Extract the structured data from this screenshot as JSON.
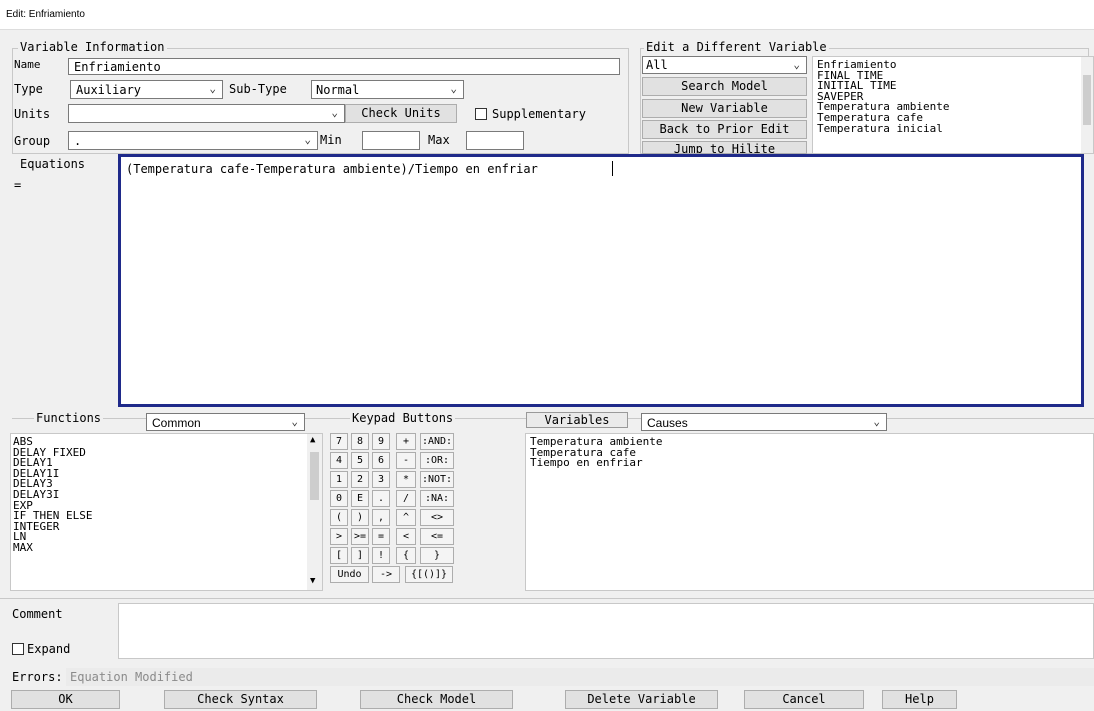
{
  "window_title": "Edit: Enfriamiento",
  "variable_info": {
    "legend": "Variable Information",
    "name_label": "Name",
    "name_value": "Enfriamiento",
    "type_label": "Type",
    "type_value": "Auxiliary",
    "subtype_label": "Sub-Type",
    "subtype_value": "Normal",
    "units_label": "Units",
    "units_value": "",
    "check_units": "Check Units",
    "supplementary": "Supplementary",
    "group_label": "Group",
    "group_value": ".",
    "min_label": "Min",
    "max_label": "Max"
  },
  "edit_different": {
    "legend": "Edit a Different Variable",
    "filter_value": "All",
    "search_model": "Search Model",
    "new_variable": "New Variable",
    "back_prior": "Back to Prior Edit",
    "jump_hilite": "Jump to Hilite",
    "variables": [
      "Enfriamiento",
      "FINAL TIME",
      "INITIAL TIME",
      "SAVEPER",
      "Temperatura ambiente",
      "Temperatura cafe",
      "Temperatura inicial"
    ]
  },
  "equations": {
    "label": "Equations",
    "equals": "=",
    "text": "(Temperatura cafe-Temperatura ambiente)/Tiempo en enfriar"
  },
  "functions": {
    "label": "Functions",
    "category": "Common",
    "items": [
      "ABS",
      "DELAY FIXED",
      "DELAY1",
      "DELAY1I",
      "DELAY3",
      "DELAY3I",
      "EXP",
      "IF THEN ELSE",
      "INTEGER",
      "LN",
      "MAX"
    ]
  },
  "keypad": {
    "label": "Keypad Buttons",
    "undo": "Undo",
    "rows": [
      [
        "7",
        "8",
        "9",
        "+",
        ":AND:"
      ],
      [
        "4",
        "5",
        "6",
        "-",
        ":OR:"
      ],
      [
        "1",
        "2",
        "3",
        "*",
        ":NOT:"
      ],
      [
        "0",
        "E",
        ".",
        "/",
        ":NA:"
      ],
      [
        "(",
        ")",
        ",",
        "^",
        "<>"
      ],
      [
        ">",
        ">=",
        "=",
        "<",
        "<="
      ],
      [
        "[",
        "]",
        "!",
        "{",
        "}"
      ]
    ],
    "bottom_row": [
      "->",
      "{[()]}"
    ]
  },
  "variables_panel": {
    "tab": "Variables",
    "mode": "Causes",
    "items": [
      "Temperatura ambiente",
      "Temperatura cafe",
      "Tiempo en enfriar"
    ]
  },
  "comment": {
    "label": "Comment",
    "expand": "Expand",
    "value": ""
  },
  "errors": {
    "label": "Errors:",
    "message": "Equation Modified"
  },
  "buttons": {
    "ok": "OK",
    "check_syntax": "Check Syntax",
    "check_model": "Check Model",
    "delete_variable": "Delete Variable",
    "cancel": "Cancel",
    "help": "Help"
  }
}
